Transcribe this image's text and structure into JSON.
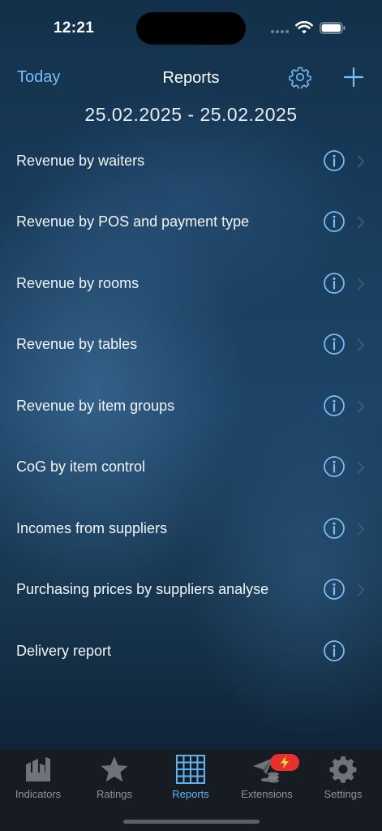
{
  "status_bar": {
    "time": "12:21"
  },
  "nav": {
    "today_label": "Today",
    "title": "Reports",
    "accent_color": "#78bdf5"
  },
  "date_range": "25.02.2025 - 25.02.2025",
  "reports": [
    {
      "label": "Revenue by waiters"
    },
    {
      "label": "Revenue by POS and payment type"
    },
    {
      "label": "Revenue by rooms"
    },
    {
      "label": "Revenue by tables"
    },
    {
      "label": "Revenue by item groups"
    },
    {
      "label": "CoG by item control"
    },
    {
      "label": "Incomes from suppliers"
    },
    {
      "label": "Purchasing prices by suppliers analyse"
    },
    {
      "label": "Delivery report"
    }
  ],
  "tab_bar": {
    "tabs": [
      {
        "label": "Indicators",
        "icon": "indicators-icon"
      },
      {
        "label": "Ratings",
        "icon": "star-icon"
      },
      {
        "label": "Reports",
        "icon": "grid-icon",
        "active": true
      },
      {
        "label": "Extensions",
        "icon": "extensions-icon"
      },
      {
        "label": "Settings",
        "icon": "gear-icon"
      }
    ],
    "active_color": "#5fb3f5",
    "inactive_color": "#8d9399",
    "badge_color": "#e8302c"
  }
}
